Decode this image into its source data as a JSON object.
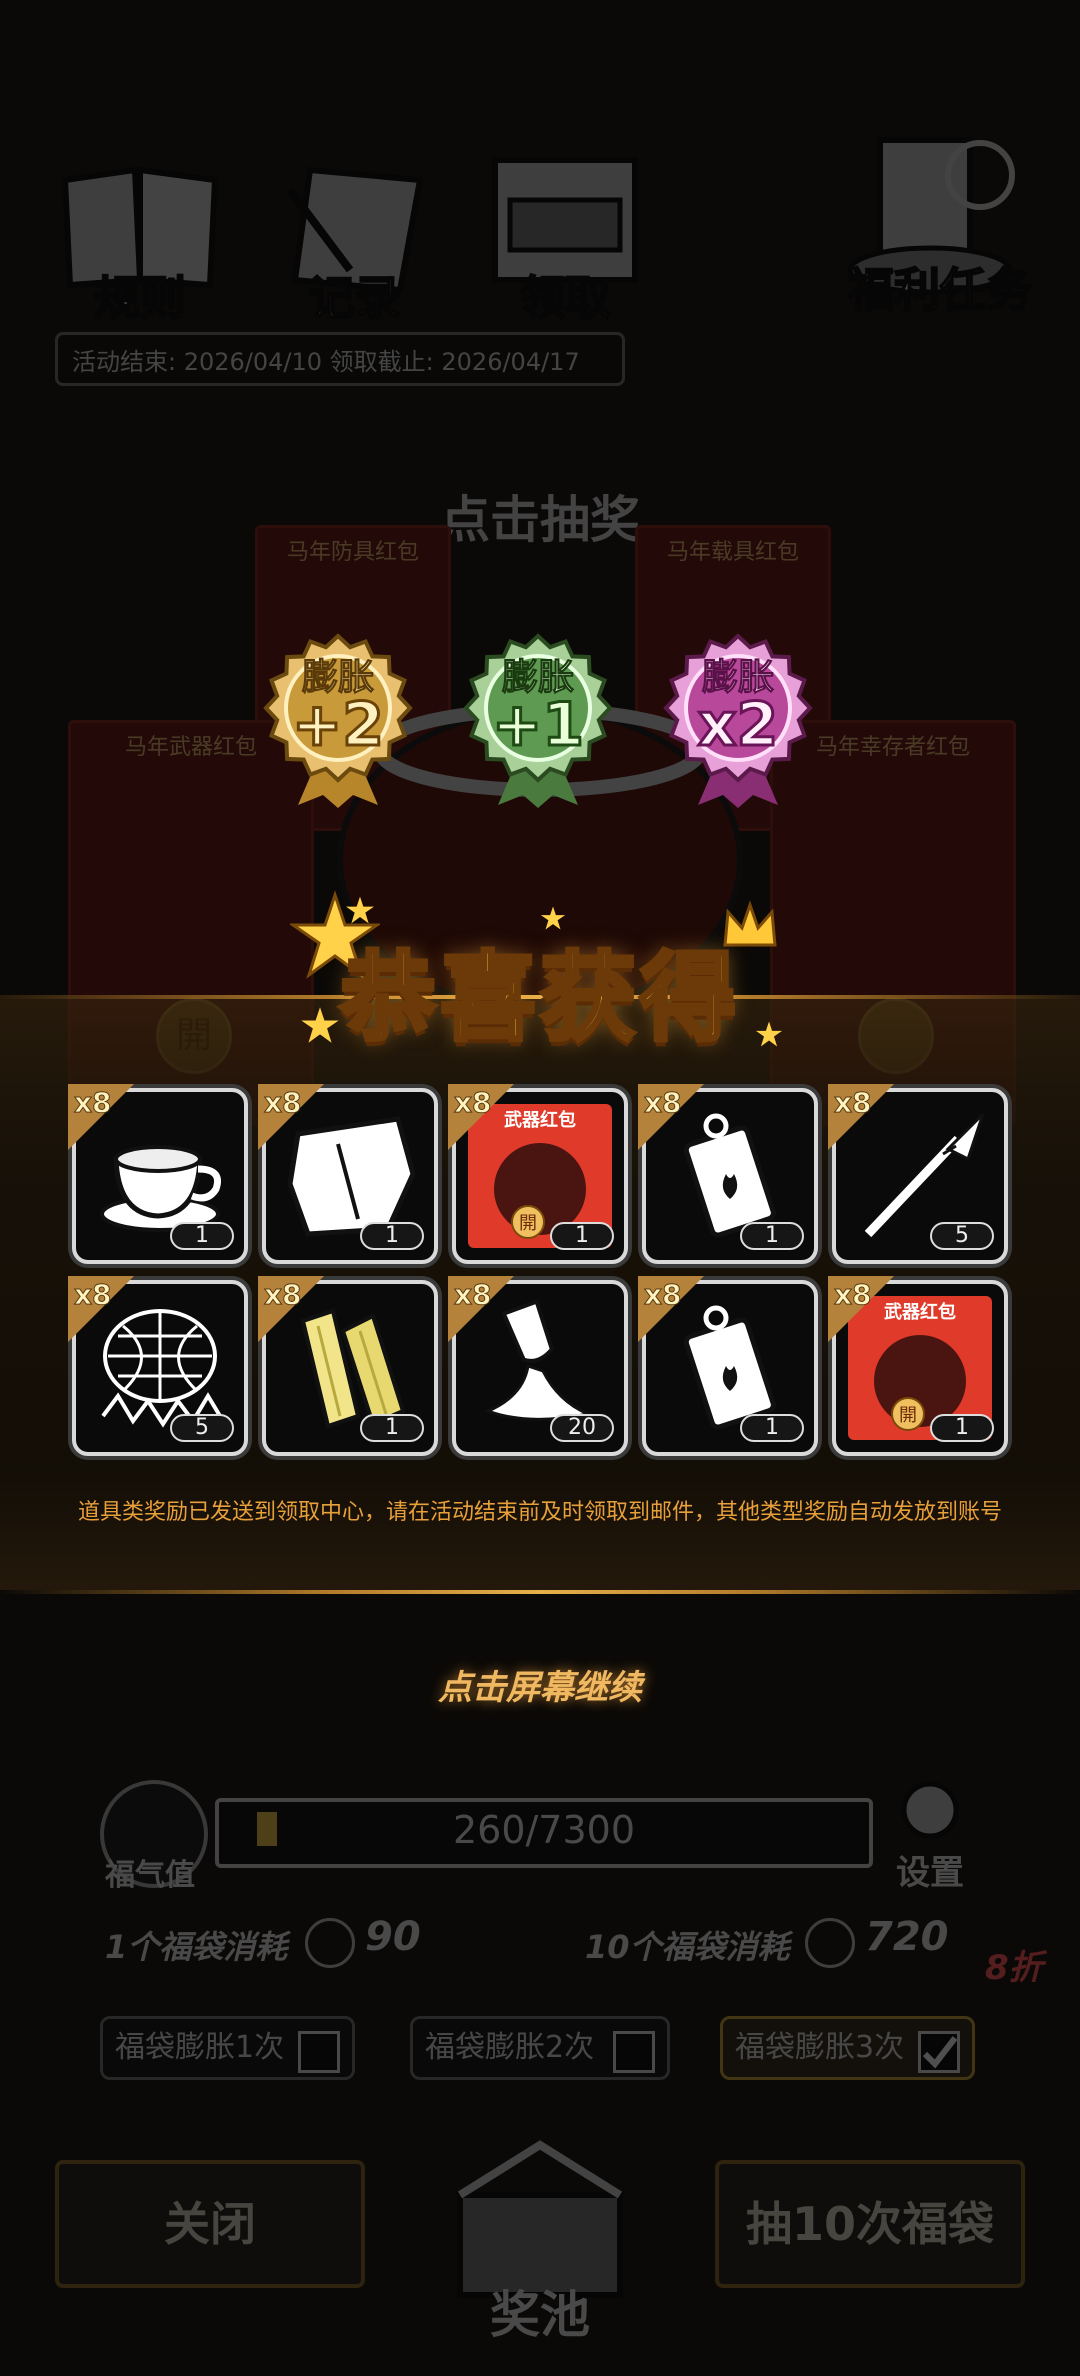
{
  "top_icons": [
    {
      "label": "规则",
      "icon": "rule-book-icon"
    },
    {
      "label": "记录",
      "icon": "record-clipboard-icon"
    },
    {
      "label": "领取",
      "icon": "claim-box-icon"
    },
    {
      "label": "福利任务",
      "icon": "welfare-task-icon"
    }
  ],
  "event_dates": "活动结束: 2026/04/10  领取截止: 2026/04/17",
  "draw_hint": "点击抽奖",
  "envelopes": [
    {
      "title": "马年防具红包"
    },
    {
      "title": "马年载具红包"
    },
    {
      "title": "马年武器红包"
    },
    {
      "title": "马年幸存者红包"
    },
    {
      "seal": "開"
    }
  ],
  "badges": [
    {
      "label": "膨胀",
      "value": "+2",
      "color": "#c89a3a"
    },
    {
      "label": "膨胀",
      "value": "+1",
      "color": "#5f9a52"
    },
    {
      "label": "膨胀",
      "value": "x2",
      "color": "#b8489a"
    }
  ],
  "result_title": "恭喜获得",
  "rewards": [
    {
      "icon": "coffee-cup-icon",
      "multiplier": "x8",
      "count": "1"
    },
    {
      "icon": "cloth-icon",
      "multiplier": "x8",
      "count": "1"
    },
    {
      "icon": "weapon-red-packet-icon",
      "multiplier": "x8",
      "count": "1",
      "tag": "武器红包",
      "seal": "開"
    },
    {
      "icon": "fuel-canister-icon",
      "multiplier": "x8",
      "count": "1"
    },
    {
      "icon": "spear-icon",
      "multiplier": "x8",
      "count": "5"
    },
    {
      "icon": "net-trap-icon",
      "multiplier": "x8",
      "count": "5"
    },
    {
      "icon": "wood-planks-icon",
      "multiplier": "x8",
      "count": "1"
    },
    {
      "icon": "glue-tube-icon",
      "multiplier": "x8",
      "count": "20"
    },
    {
      "icon": "fuel-canister-icon",
      "multiplier": "x8",
      "count": "1"
    },
    {
      "icon": "weapon-red-packet-icon",
      "multiplier": "x8",
      "count": "1",
      "tag": "武器红包",
      "seal": "開"
    }
  ],
  "notice": "道具类奖励已发送到领取中心，请在活动结束前及时领取到邮件，其他类型奖励自动发放到账号",
  "tap_continue": "点击屏幕继续",
  "fortune": {
    "label": "福气值",
    "progress_text": "260/7300",
    "progress": 0.0356
  },
  "settings_label": "设置",
  "cost_single": {
    "label": "1个福袋消耗",
    "value": "90",
    "currency": "福气值"
  },
  "cost_ten": {
    "label": "10个福袋消耗",
    "value": "720",
    "currency": "福气值",
    "discount": "8折"
  },
  "expand_options": [
    {
      "label": "福袋膨胀1次",
      "checked": false
    },
    {
      "label": "福袋膨胀2次",
      "checked": false
    },
    {
      "label": "福袋膨胀3次",
      "checked": true
    }
  ],
  "buttons": {
    "close": "关闭",
    "pool": "奖池",
    "draw_ten": "抽10次福袋"
  }
}
